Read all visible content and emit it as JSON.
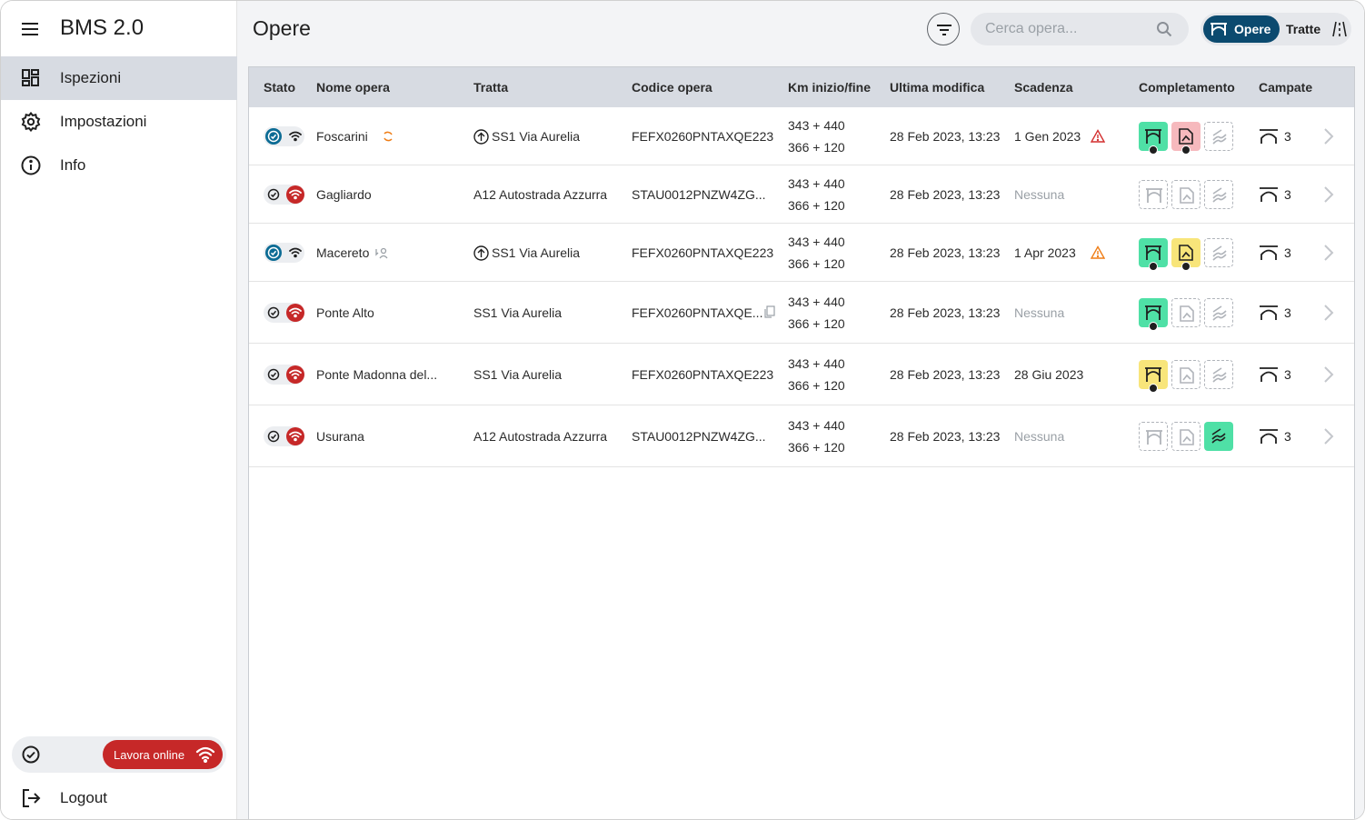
{
  "app": {
    "title": "BMS 2.0"
  },
  "sidebar": {
    "items": [
      {
        "label": "Ispezioni",
        "icon": "dashboard-icon",
        "active": true
      },
      {
        "label": "Impostazioni",
        "icon": "gear-icon",
        "active": false
      },
      {
        "label": "Info",
        "icon": "info-icon",
        "active": false
      }
    ],
    "online_label": "Lavora online",
    "logout_label": "Logout"
  },
  "header": {
    "title": "Opere",
    "search_placeholder": "Cerca opera...",
    "toggle": {
      "opere": "Opere",
      "tratte": "Tratte",
      "selected": "Opere"
    }
  },
  "table": {
    "headers": {
      "stato": "Stato",
      "nome": "Nome opera",
      "tratta": "Tratta",
      "codice": "Codice opera",
      "km": "Km inizio/fine",
      "modifica": "Ultima modifica",
      "scadenza": "Scadenza",
      "completamento": "Completamento",
      "campate": "Campate"
    },
    "rows": [
      {
        "stato": "offline-ready",
        "nome": "Foscarini",
        "nome_icon": "sync-icon",
        "tratta": "SS1 Via Aurelia",
        "tratta_icon": "direction-icon",
        "codice": "FEFX0260PNTAXQE223",
        "km_inizio": "343 + 440",
        "km_fine": "366 + 120",
        "modifica": "28 Feb 2023, 13:23",
        "scadenza": "1 Gen 2023",
        "scadenza_alert": "red",
        "completamento": [
          "green-person",
          "pink-person",
          "off"
        ],
        "campate": "3"
      },
      {
        "stato": "online",
        "nome": "Gagliardo",
        "tratta": "A12 Autostrada Azzurra",
        "codice": "STAU0012PNZW4ZG...",
        "km_inizio": "343 + 440",
        "km_fine": "366 + 120",
        "modifica": "28 Feb 2023, 13:23",
        "scadenza": "Nessuna",
        "completamento": [
          "off",
          "off",
          "off"
        ],
        "campate": "3"
      },
      {
        "stato": "offline-ready",
        "nome": "Macereto",
        "nome_icon": "person-sync-icon",
        "tratta": "SS1 Via Aurelia",
        "tratta_icon": "direction-icon",
        "codice": "FEFX0260PNTAXQE223",
        "km_inizio": "343 + 440",
        "km_fine": "366 + 120",
        "modifica": "28 Feb 2023, 13:23",
        "scadenza": "1 Apr 2023",
        "scadenza_alert": "orange",
        "completamento": [
          "green-person",
          "yellow-person",
          "off"
        ],
        "campate": "3"
      },
      {
        "stato": "online",
        "nome": "Ponte Alto",
        "tratta": "SS1 Via Aurelia",
        "codice": "FEFX0260PNTAXQE...",
        "codice_icon": "copy-icon",
        "km_inizio": "343 + 440",
        "km_fine": "366 + 120",
        "modifica": "28 Feb 2023, 13:23",
        "scadenza": "Nessuna",
        "completamento": [
          "green-person",
          "off",
          "off"
        ],
        "campate": "3"
      },
      {
        "stato": "online",
        "nome": "Ponte Madonna del...",
        "tratta": "SS1 Via Aurelia",
        "codice": "FEFX0260PNTAXQE223",
        "km_inizio": "343 + 440",
        "km_fine": "366 + 120",
        "modifica": "28 Feb 2023, 13:23",
        "scadenza": "28 Giu 2023",
        "completamento": [
          "yellow-person",
          "off",
          "off"
        ],
        "campate": "3"
      },
      {
        "stato": "online",
        "nome": "Usurana",
        "tratta": "A12 Autostrada Azzurra",
        "codice": "STAU0012PNZW4ZG...",
        "km_inizio": "343 + 440",
        "km_fine": "366 + 120",
        "modifica": "28 Feb 2023, 13:23",
        "scadenza": "Nessuna",
        "completamento": [
          "off",
          "off",
          "green"
        ],
        "campate": "3"
      }
    ]
  },
  "colors": {
    "accent": "#0b4a6f",
    "online_red": "#c62828",
    "green": "#4fe0a6",
    "pink": "#f6b9bd",
    "yellow": "#f8e57a",
    "alert_red": "#d32f2f",
    "alert_orange": "#ef7d16"
  }
}
